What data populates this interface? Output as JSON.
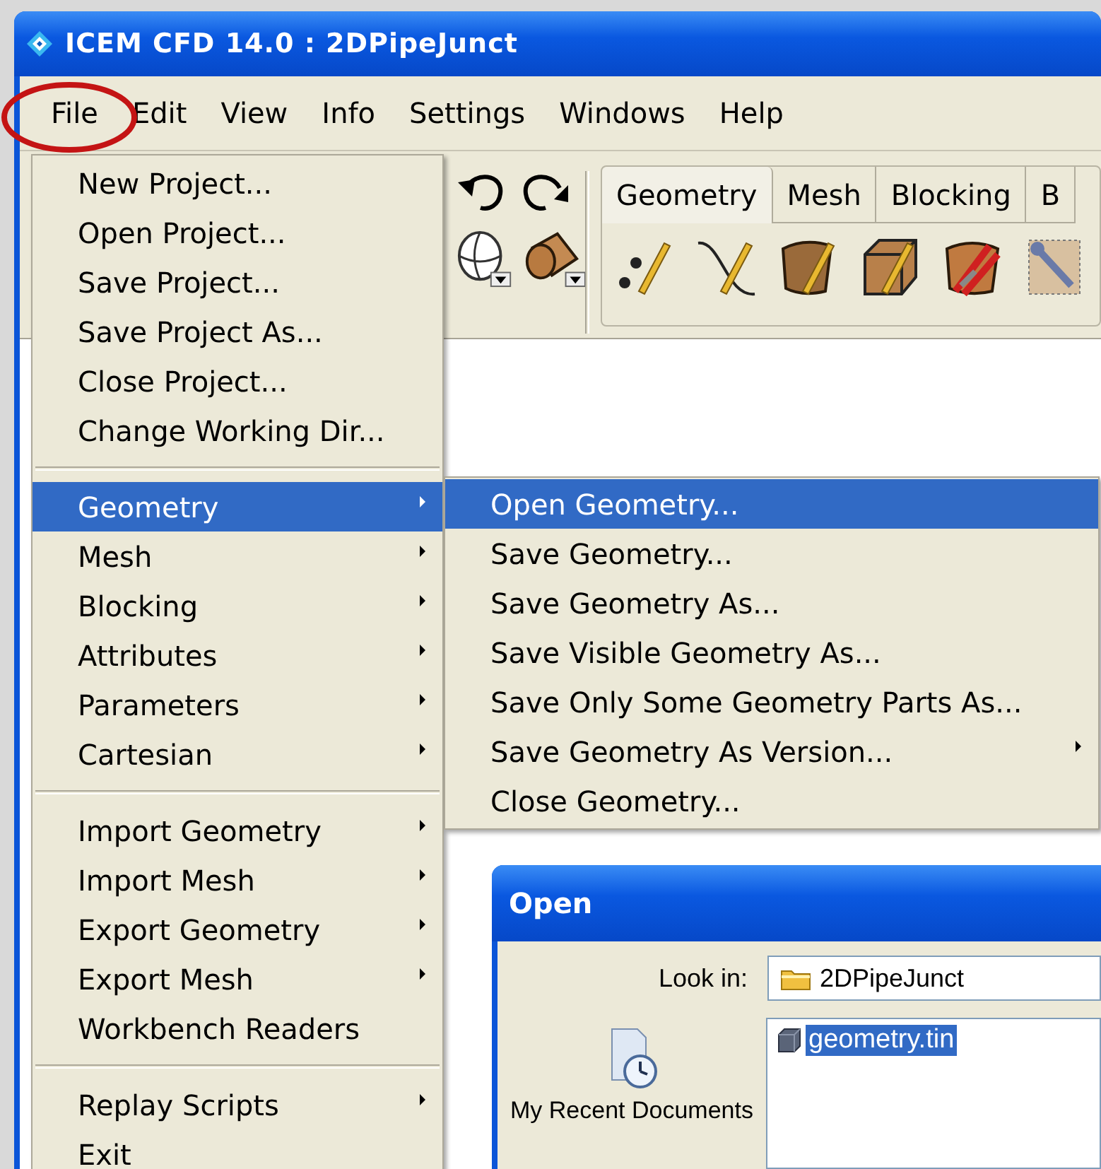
{
  "window": {
    "title": "ICEM CFD 14.0 : 2DPipeJunct"
  },
  "menu_bar": [
    "File",
    "Edit",
    "View",
    "Info",
    "Settings",
    "Windows",
    "Help"
  ],
  "toolbar_tabs": [
    {
      "label": "Geometry",
      "selected": true
    },
    {
      "label": "Mesh",
      "selected": false
    },
    {
      "label": "Blocking",
      "selected": false
    },
    {
      "label": "B",
      "selected": false
    }
  ],
  "file_menu": {
    "sections": [
      [
        {
          "label": "New Project...",
          "submenu": false,
          "selected": false
        },
        {
          "label": "Open Project...",
          "submenu": false,
          "selected": false
        },
        {
          "label": "Save Project...",
          "submenu": false,
          "selected": false
        },
        {
          "label": "Save Project As...",
          "submenu": false,
          "selected": false
        },
        {
          "label": "Close Project...",
          "submenu": false,
          "selected": false
        },
        {
          "label": "Change Working Dir...",
          "submenu": false,
          "selected": false
        }
      ],
      [
        {
          "label": "Geometry",
          "submenu": true,
          "selected": true
        },
        {
          "label": "Mesh",
          "submenu": true,
          "selected": false
        },
        {
          "label": "Blocking",
          "submenu": true,
          "selected": false
        },
        {
          "label": "Attributes",
          "submenu": true,
          "selected": false
        },
        {
          "label": "Parameters",
          "submenu": true,
          "selected": false
        },
        {
          "label": "Cartesian",
          "submenu": true,
          "selected": false
        }
      ],
      [
        {
          "label": "Import Geometry",
          "submenu": true,
          "selected": false
        },
        {
          "label": "Import Mesh",
          "submenu": true,
          "selected": false
        },
        {
          "label": "Export Geometry",
          "submenu": true,
          "selected": false
        },
        {
          "label": "Export Mesh",
          "submenu": true,
          "selected": false
        },
        {
          "label": "Workbench Readers",
          "submenu": false,
          "selected": false
        }
      ],
      [
        {
          "label": "Replay Scripts",
          "submenu": true,
          "selected": false
        },
        {
          "label": "Exit",
          "submenu": false,
          "selected": false
        }
      ]
    ]
  },
  "geometry_submenu": [
    {
      "label": "Open Geometry...",
      "submenu": false,
      "selected": true
    },
    {
      "label": "Save Geometry...",
      "submenu": false,
      "selected": false
    },
    {
      "label": "Save Geometry As...",
      "submenu": false,
      "selected": false
    },
    {
      "label": "Save Visible Geometry As...",
      "submenu": false,
      "selected": false
    },
    {
      "label": "Save Only Some Geometry Parts As...",
      "submenu": false,
      "selected": false
    },
    {
      "label": "Save Geometry As Version...",
      "submenu": true,
      "selected": false
    },
    {
      "label": "Close Geometry...",
      "submenu": false,
      "selected": false
    }
  ],
  "open_dialog": {
    "title": "Open",
    "look_in_label": "Look in:",
    "look_in_value": "2DPipeJunct",
    "places": [
      "My Recent Documents"
    ],
    "files": [
      {
        "name": "geometry.tin",
        "selected": true
      }
    ]
  }
}
